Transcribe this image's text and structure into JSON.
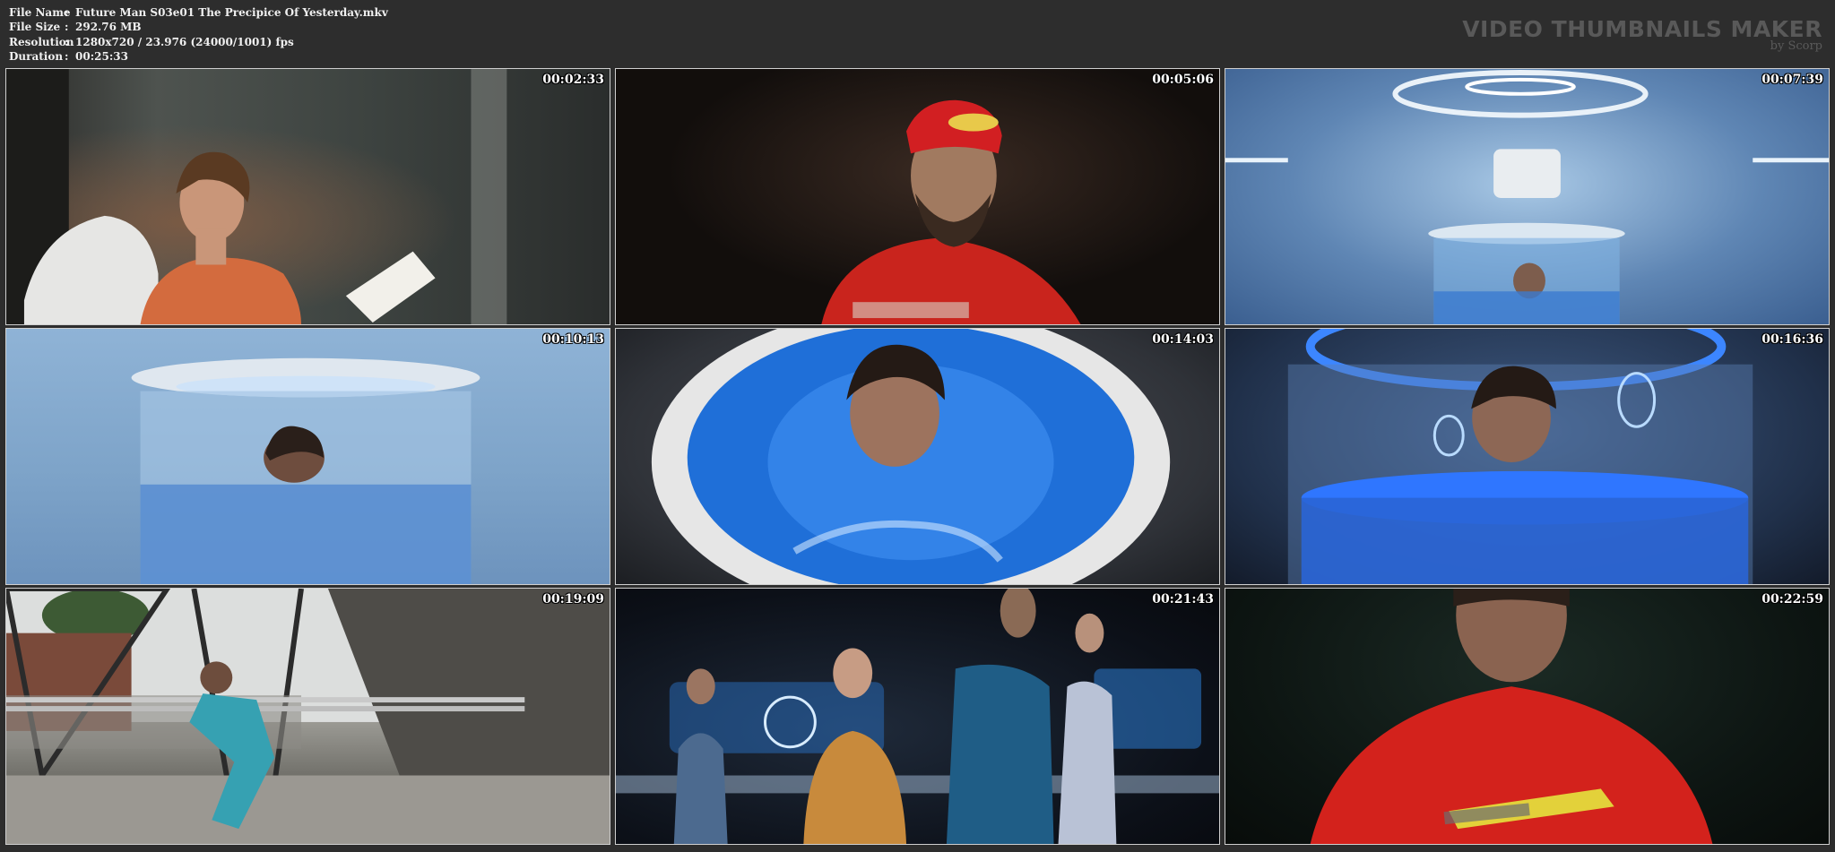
{
  "file_info": {
    "rows": [
      {
        "label": "File Name",
        "sep": ":",
        "value": "Future Man S03e01 The Precipice Of Yesterday.mkv"
      },
      {
        "label": "File Size",
        "sep": ":",
        "value": "292.76 MB"
      },
      {
        "label": "Resolution",
        "sep": ":",
        "value": "1280x720 / 23.976 (24000/1001) fps"
      },
      {
        "label": "Duration",
        "sep": ":",
        "value": "00:25:33"
      }
    ]
  },
  "brand": {
    "title": "VIDEO THUMBNAILS MAKER",
    "byline": "by Scorp"
  },
  "thumbnails": [
    {
      "timestamp": "00:02:33",
      "scene": "woman-reading-on-couch"
    },
    {
      "timestamp": "00:05:06",
      "scene": "man-red-bandana-dark-room"
    },
    {
      "timestamp": "00:07:39",
      "scene": "man-in-blue-tank-room"
    },
    {
      "timestamp": "00:10:13",
      "scene": "man-in-cylinder-tank"
    },
    {
      "timestamp": "00:14:03",
      "scene": "man-in-blue-water-topdown"
    },
    {
      "timestamp": "00:16:36",
      "scene": "man-in-glowing-tank-closeup"
    },
    {
      "timestamp": "00:19:09",
      "scene": "man-on-parallel-bars-outdoor"
    },
    {
      "timestamp": "00:21:43",
      "scene": "group-in-control-room"
    },
    {
      "timestamp": "00:22:59",
      "scene": "man-red-shirt-dark-closeup"
    }
  ],
  "colors": {
    "background": "#2d2d2d",
    "frame_border": "#cfcfcf",
    "brand_text": "#595959",
    "info_text": "#f0f0f0"
  }
}
